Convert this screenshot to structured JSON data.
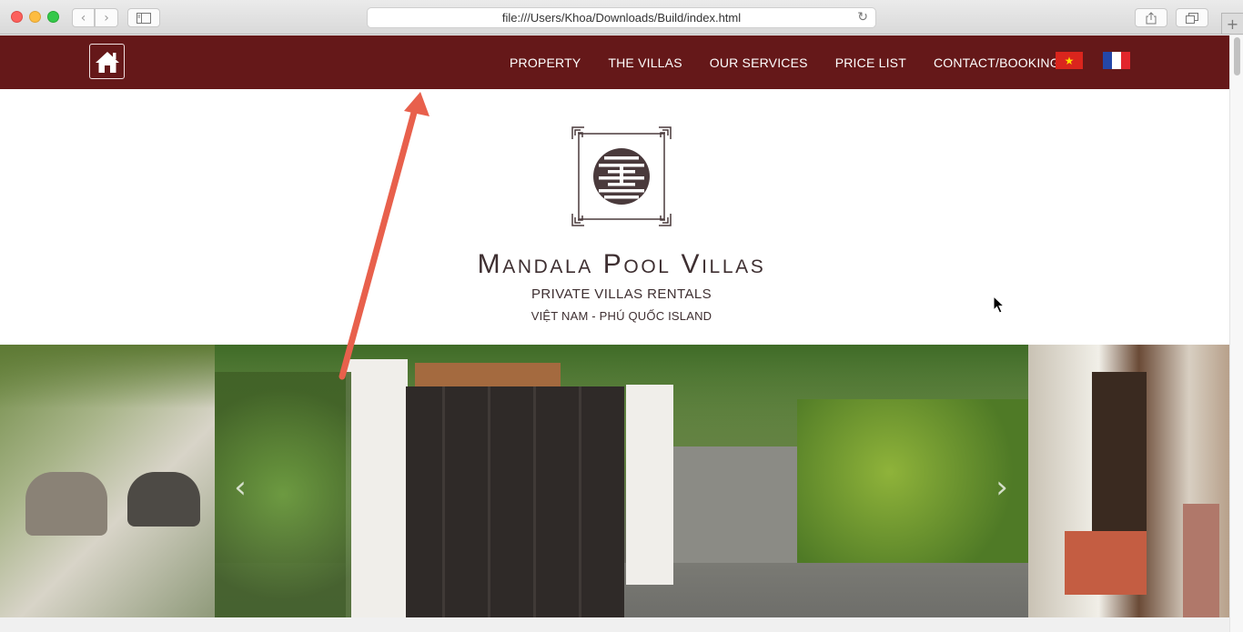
{
  "browser": {
    "url": "file:///Users/Khoa/Downloads/Build/index.html",
    "back_icon": "chevron-left-icon",
    "forward_icon": "chevron-right-icon",
    "sidebar_icon": "sidebar-icon",
    "share_icon": "share-icon",
    "tabs_icon": "tabs-icon",
    "reload_icon": "reload-icon",
    "newtab_icon": "plus-icon"
  },
  "nav": {
    "background": "#651819",
    "home_icon": "home-icon",
    "items": [
      {
        "label": "PROPERTY"
      },
      {
        "label": "THE VILLAS"
      },
      {
        "label": "OUR SERVICES"
      },
      {
        "label": "PRICE LIST"
      },
      {
        "label": "CONTACT/BOOKING"
      }
    ],
    "flags": [
      "vietnam-flag-icon",
      "france-flag-icon"
    ]
  },
  "brand": {
    "name": "Mandala Pool Villas",
    "subtitle": "PRIVATE VILLAS RENTALS",
    "location": "VIỆT NAM - PHÚ QUỐC ISLAND",
    "logo_icon": "mandala-logo-icon",
    "text_color": "#3e2f31"
  },
  "slider": {
    "prev_label": "‹",
    "next_label": "›"
  },
  "annotation": {
    "color": "#e8604c"
  }
}
